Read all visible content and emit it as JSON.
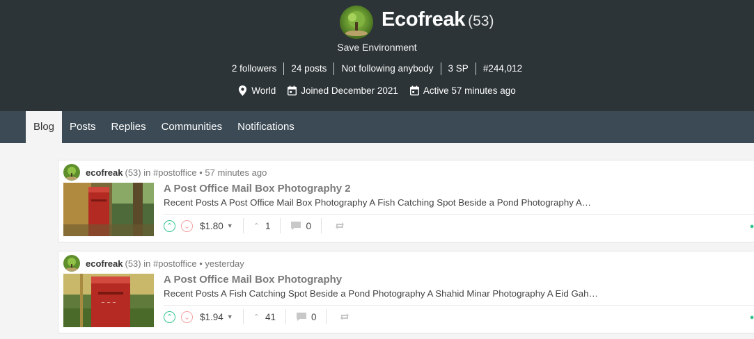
{
  "profile": {
    "name": "Ecofreak",
    "reputation": "(53)",
    "about": "Save Environment",
    "stats": [
      "2 followers",
      "24 posts",
      "Not following anybody",
      "3 SP",
      "#244,012"
    ],
    "location": "World",
    "joined": "Joined December 2021",
    "active": "Active 57 minutes ago"
  },
  "tabs": [
    "Blog",
    "Posts",
    "Replies",
    "Communities",
    "Notifications"
  ],
  "active_tab": "Blog",
  "posts": [
    {
      "author": "ecofreak",
      "author_rep": "(53)",
      "in_label": "in",
      "community": "#postoffice",
      "time": "• 57 minutes ago",
      "title": "A Post Office Mail Box Photography 2",
      "summary": "Recent Posts A Post Office Mail Box Photography A Fish Catching Spot Beside a Pond Photography A…",
      "payout": "$1.80",
      "votes": "1",
      "comments": "0"
    },
    {
      "author": "ecofreak",
      "author_rep": "(53)",
      "in_label": "in",
      "community": "#postoffice",
      "time": "• yesterday",
      "title": "A Post Office Mail Box Photography",
      "summary": "Recent Posts A Fish Catching Spot Beside a Pond Photography A Shahid Minar Photography A Eid Gah…",
      "payout": "$1.94",
      "votes": "41",
      "comments": "0"
    }
  ],
  "colors": {
    "header_bg": "#2c3437",
    "tabbar_bg": "#3b4a55",
    "upvote": "#35c58c",
    "downvote": "#f2a3a3"
  },
  "icons": [
    "location-pin-icon",
    "calendar-icon",
    "upvote-icon",
    "downvote-icon",
    "caret-down-icon",
    "chevron-up-icon",
    "comment-icon",
    "reblog-icon",
    "more-icon"
  ]
}
